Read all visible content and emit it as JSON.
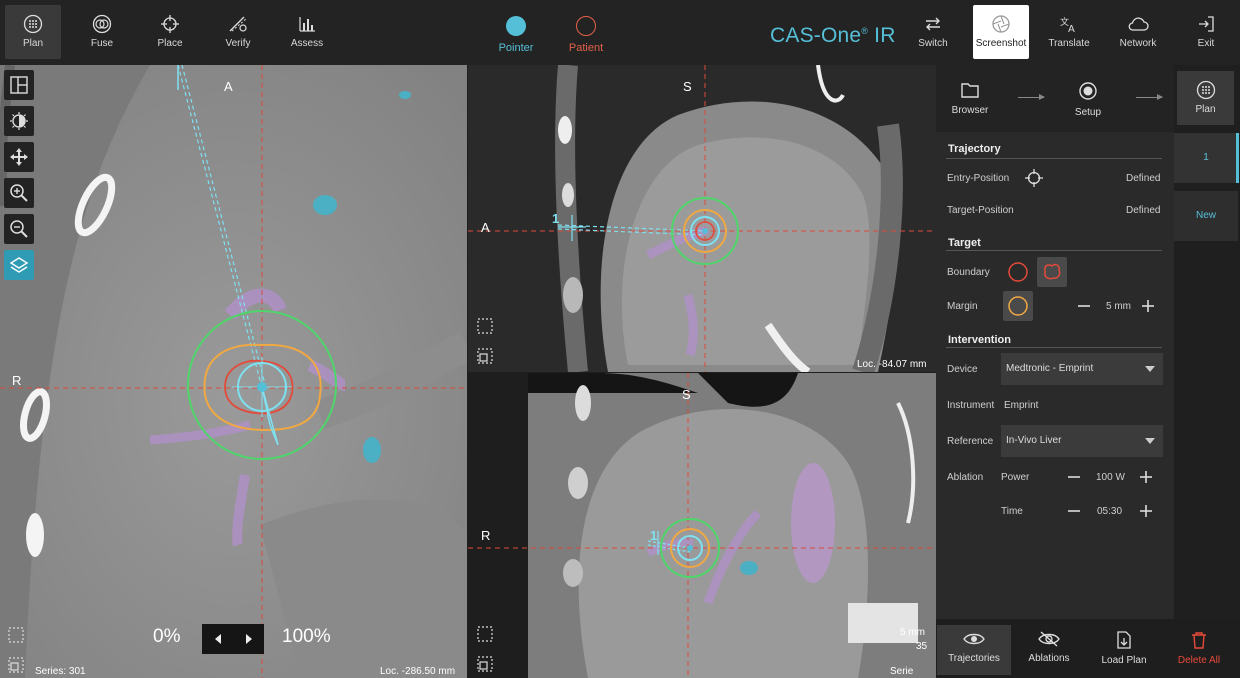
{
  "toolbar": {
    "left": [
      {
        "label": "Plan",
        "icon": "plan-icon"
      },
      {
        "label": "Fuse",
        "icon": "fuse-icon"
      },
      {
        "label": "Place",
        "icon": "place-icon"
      },
      {
        "label": "Verify",
        "icon": "verify-icon"
      },
      {
        "label": "Assess",
        "icon": "assess-icon"
      }
    ],
    "modes": [
      {
        "label": "Pointer",
        "color": "#56bfd8"
      },
      {
        "label": "Patient",
        "color": "#e3624a"
      }
    ],
    "brand_name": "CAS-One",
    "brand_mark": "®",
    "brand_suffix": "IR",
    "right": [
      {
        "label": "Switch",
        "icon": "switch-icon"
      },
      {
        "label": "Screenshot",
        "icon": "screenshot-icon"
      },
      {
        "label": "Translate",
        "icon": "translate-icon"
      },
      {
        "label": "Network",
        "icon": "cloud-icon"
      },
      {
        "label": "Exit",
        "icon": "exit-icon"
      }
    ]
  },
  "views": {
    "axial": {
      "top": "A",
      "left": "R",
      "series": "Series: 301",
      "loc": "Loc. -286.50 mm"
    },
    "coronal": {
      "top": "S",
      "left": "A",
      "loc": "Loc. -84.07 mm",
      "marker": "1"
    },
    "sagittal": {
      "top": "S",
      "left": "R",
      "marker": "1",
      "partial_mm": "5 mm",
      "partial_num": "35",
      "partial_series": "Serie"
    }
  },
  "opacity": {
    "min": "0%",
    "max": "100%"
  },
  "workflow": {
    "steps": [
      {
        "label": "Browser",
        "icon": "folder-icon"
      },
      {
        "label": "Setup",
        "icon": "target-icon"
      },
      {
        "label": "Plan",
        "icon": "plan-icon"
      }
    ]
  },
  "trajectory": {
    "title": "Trajectory",
    "entry_label": "Entry-Position",
    "entry_value": "Defined",
    "target_label": "Target-Position",
    "target_value": "Defined"
  },
  "target": {
    "title": "Target",
    "boundary_label": "Boundary",
    "margin_label": "Margin",
    "margin_value": "5 mm"
  },
  "intervention": {
    "title": "Intervention",
    "device_label": "Device",
    "device_value": "Medtronic - Emprint",
    "instrument_label": "Instrument",
    "instrument_value": "Emprint",
    "reference_label": "Reference",
    "reference_value": "In-Vivo Liver",
    "ablation_label": "Ablation",
    "power_label": "Power",
    "power_value": "100 W",
    "time_label": "Time",
    "time_value": "05:30"
  },
  "plans": {
    "tab_label": "Plan",
    "items": [
      "1"
    ],
    "new_label": "New"
  },
  "bottom": [
    {
      "label": "Trajectories",
      "icon": "eye-icon"
    },
    {
      "label": "Ablations",
      "icon": "eye-off-icon"
    },
    {
      "label": "Load Plan",
      "icon": "load-plan-icon"
    },
    {
      "label": "Delete All",
      "icon": "trash-icon",
      "color": "#e84a3a"
    }
  ]
}
